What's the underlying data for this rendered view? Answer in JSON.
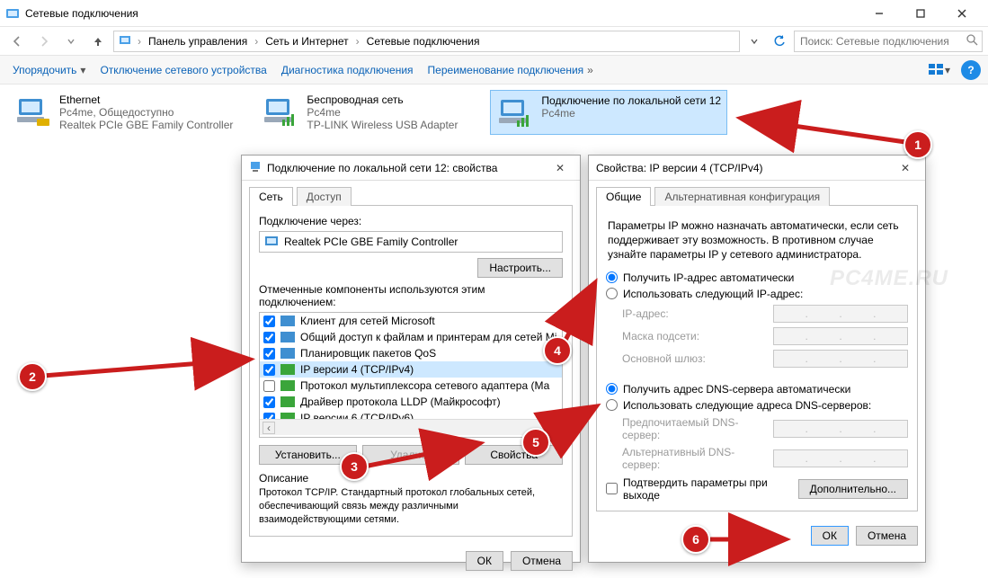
{
  "window": {
    "title": "Сетевые подключения"
  },
  "breadcrumb": {
    "root": "Панель управления",
    "l1": "Сеть и Интернет",
    "l2": "Сетевые подключения"
  },
  "search": {
    "placeholder": "Поиск: Сетевые подключения"
  },
  "cmdbar": {
    "organize": "Упорядочить",
    "disable": "Отключение сетевого устройства",
    "diagnose": "Диагностика подключения",
    "rename": "Переименование подключения"
  },
  "conns": {
    "eth": {
      "title": "Ethernet",
      "sub": "Pc4me, Общедоступно",
      "desc": "Realtek PCIe GBE Family Controller"
    },
    "wifi": {
      "title": "Беспроводная сеть",
      "sub": "Pc4me",
      "desc": "TP-LINK Wireless USB Adapter"
    },
    "lan": {
      "title": "Подключение по локальной сети 12",
      "sub": "Pc4me",
      "desc": ""
    }
  },
  "dlg1": {
    "title": "Подключение по локальной сети 12: свойства",
    "tab_net": "Сеть",
    "tab_access": "Доступ",
    "connect_via": "Подключение через:",
    "adapter": "Realtek PCIe GBE Family Controller",
    "configure": "Настроить...",
    "components_lbl": "Отмеченные компоненты используются этим подключением:",
    "components": [
      "Клиент для сетей Microsoft",
      "Общий доступ к файлам и принтерам для сетей Mi",
      "Планировщик пакетов QoS",
      "IP версии 4 (TCP/IPv4)",
      "Протокол мультиплексора сетевого адаптера (Ма",
      "Драйвер протокола LLDP (Майкрософт)",
      "IP версии 6 (TCP/IPv6)"
    ],
    "install": "Установить...",
    "remove": "Удалить",
    "props": "Свойства",
    "desc_h": "Описание",
    "desc": "Протокол TCP/IP. Стандартный протокол глобальных сетей, обеспечивающий связь между различными взаимодействующими сетями.",
    "ok": "ОК",
    "cancel": "Отмена"
  },
  "dlg2": {
    "title": "Свойства: IP версии 4 (TCP/IPv4)",
    "tab_general": "Общие",
    "tab_alt": "Альтернативная конфигурация",
    "intro": "Параметры IP можно назначать автоматически, если сеть поддерживает эту возможность. В противном случае узнайте параметры IP у сетевого администратора.",
    "auto_ip": "Получить IP-адрес автоматически",
    "use_ip": "Использовать следующий IP-адрес:",
    "ip_addr": "IP-адрес:",
    "mask": "Маска подсети:",
    "gateway": "Основной шлюз:",
    "auto_dns": "Получить адрес DNS-сервера автоматически",
    "use_dns": "Использовать следующие адреса DNS-серверов:",
    "dns1": "Предпочитаемый DNS-сервер:",
    "dns2": "Альтернативный DNS-сервер:",
    "validate": "Подтвердить параметры при выходе",
    "advanced": "Дополнительно...",
    "ok": "ОК",
    "cancel": "Отмена"
  },
  "ann": {
    "1": "1",
    "2": "2",
    "3": "3",
    "4": "4",
    "5": "5",
    "6": "6"
  },
  "watermark": "PC4ME.RU"
}
